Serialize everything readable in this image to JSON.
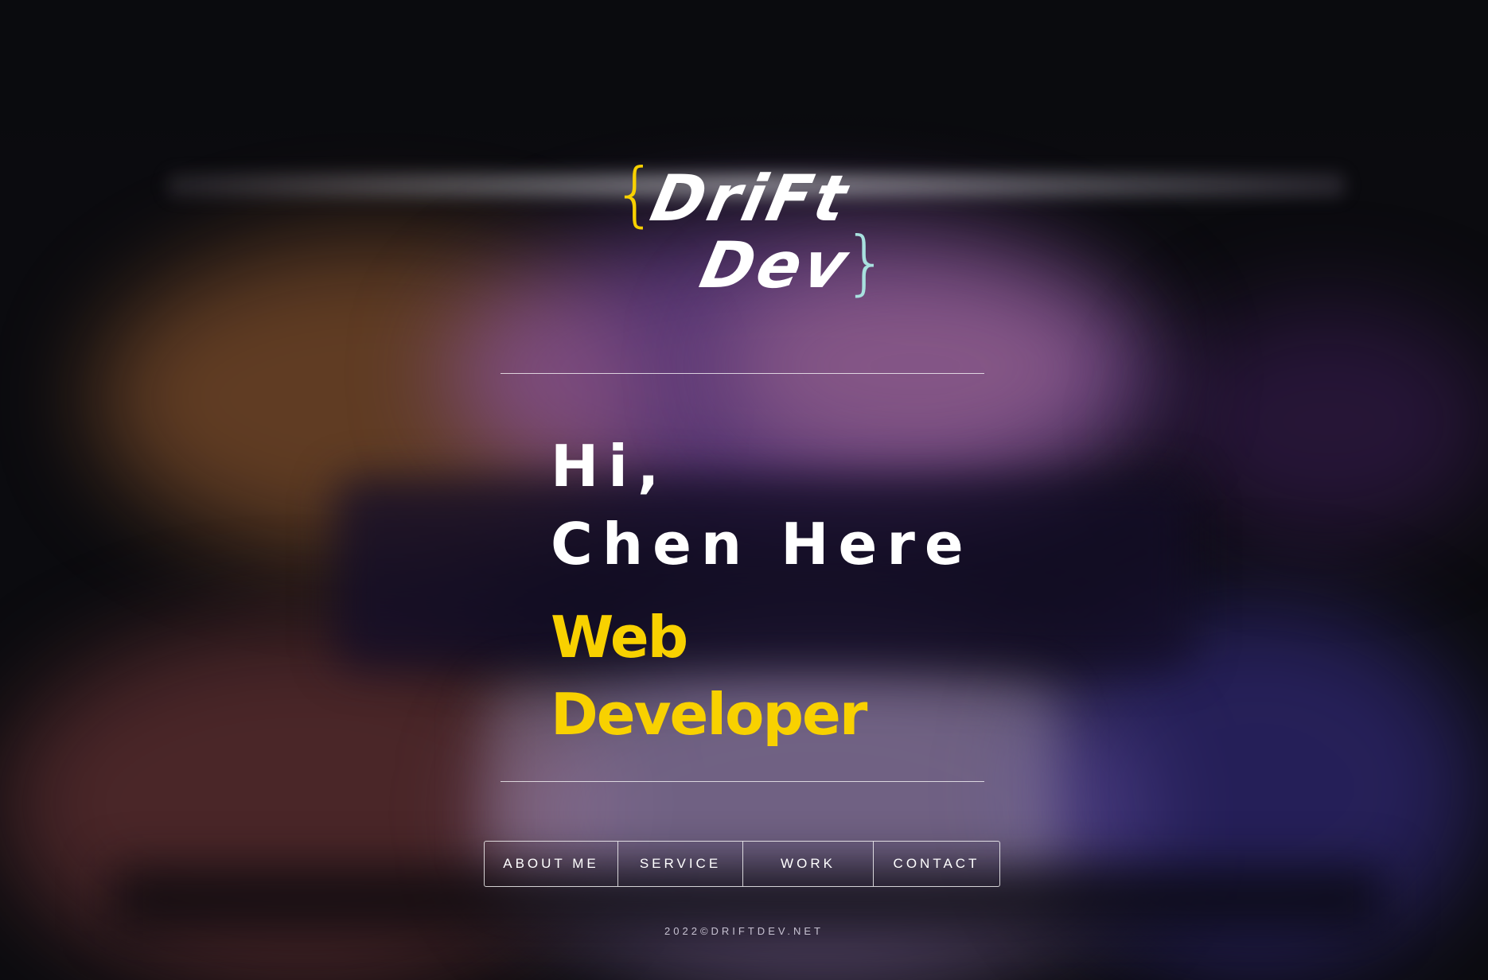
{
  "colors": {
    "accent_yellow": "#f8d100",
    "accent_cyan": "#a8e1df",
    "text_white": "#ffffff",
    "background": "#0b0b0f"
  },
  "logo": {
    "brace_open": "{",
    "word_1": "DriFt",
    "word_2": "Dev",
    "brace_close": "}"
  },
  "hero": {
    "greeting_line_1": "Hi,",
    "greeting_line_2": "Chen Here",
    "role_line_1": "Web",
    "role_line_2": "Developer"
  },
  "nav": {
    "items": [
      {
        "label": "ABOUT ME"
      },
      {
        "label": "SERVICE"
      },
      {
        "label": "WORK"
      },
      {
        "label": "CONTACT"
      }
    ]
  },
  "footer": {
    "copyright": "2022©DRIFTDEV.NET"
  }
}
